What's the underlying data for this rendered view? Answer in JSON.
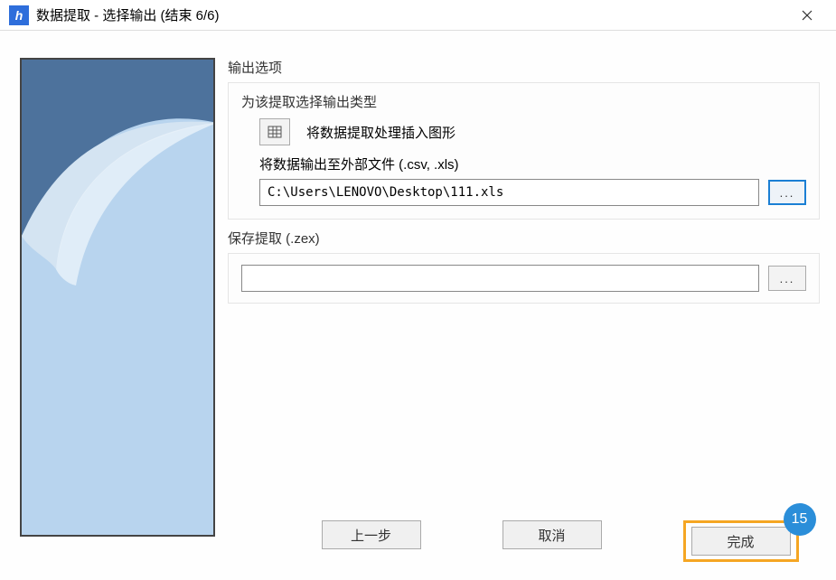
{
  "window": {
    "title": "数据提取 - 选择输出 (结束 6/6)"
  },
  "output_options": {
    "group_title": "输出选项",
    "select_label": "为该提取选择输出类型",
    "insert_label": "将数据提取处理插入图形",
    "external_label": "将数据输出至外部文件 (.csv, .xls)",
    "path_value": "C:\\Users\\LENOVO\\Desktop\\111.xls",
    "browse_label": "..."
  },
  "save_extraction": {
    "group_title": "保存提取 (.zex)",
    "path_value": "",
    "browse_label": "..."
  },
  "buttons": {
    "prev": "上一步",
    "cancel": "取消",
    "finish": "完成"
  },
  "callout": {
    "number": "15"
  }
}
